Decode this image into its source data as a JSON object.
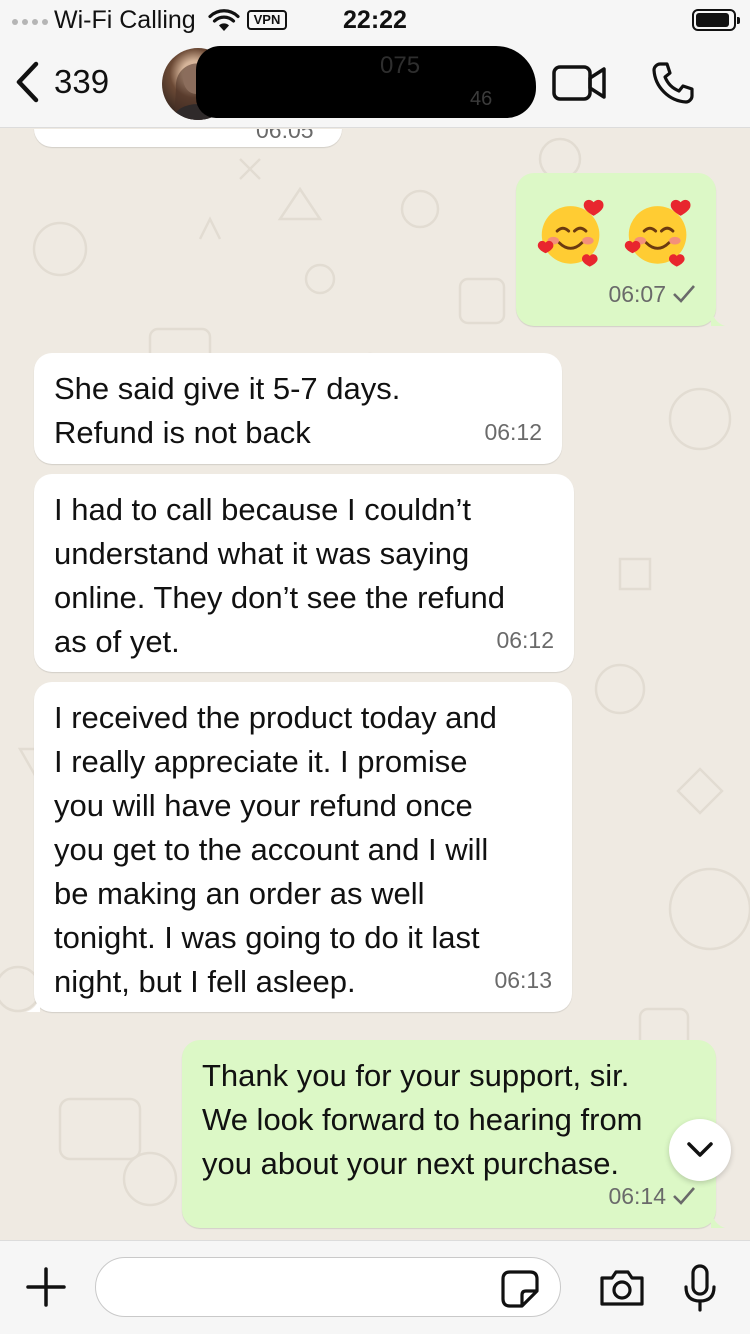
{
  "status_bar": {
    "carrier": "Wi-Fi Calling",
    "vpn_label": "VPN",
    "time": "22:22"
  },
  "header": {
    "back_count": "339",
    "contact_name_partial": "075",
    "contact_sub_partial": "46"
  },
  "messages": [
    {
      "direction": "in",
      "partial": true,
      "time": "06:05"
    },
    {
      "direction": "out",
      "emoji": [
        "smiling-face-with-hearts",
        "smiling-face-with-hearts"
      ],
      "time": "06:07",
      "status": "sent-check"
    },
    {
      "direction": "in",
      "lines": [
        "She said give it 5-7 days.",
        "Refund is not back"
      ],
      "time": "06:12"
    },
    {
      "direction": "in",
      "lines": [
        "I had to call because I couldn’t",
        "understand what it was saying",
        "online. They don’t see the refund",
        "as of yet."
      ],
      "time": "06:12"
    },
    {
      "direction": "in",
      "lines": [
        "I received the product today and",
        "I really appreciate it. I promise",
        "you will have your refund once",
        "you get to the account and I will",
        "be making an order as well",
        "tonight. I was going to do it last",
        "night, but I fell asleep."
      ],
      "time": "06:13"
    },
    {
      "direction": "out",
      "lines": [
        "Thank you for your support, sir.",
        "We look forward to hearing from",
        "you about your next purchase."
      ],
      "time": "06:14",
      "status": "sent-check"
    }
  ],
  "colors": {
    "wallpaper": "#efeae2",
    "incoming_bubble": "#ffffff",
    "outgoing_bubble": "#dcf8c6",
    "time_text": "#6a6a6a"
  },
  "input": {
    "value": "",
    "placeholder": ""
  },
  "icons": [
    "back-chevron-icon",
    "video-call-icon",
    "phone-icon",
    "chevron-down-icon",
    "plus-icon",
    "sticker-icon",
    "camera-icon",
    "microphone-icon",
    "check-icon"
  ]
}
